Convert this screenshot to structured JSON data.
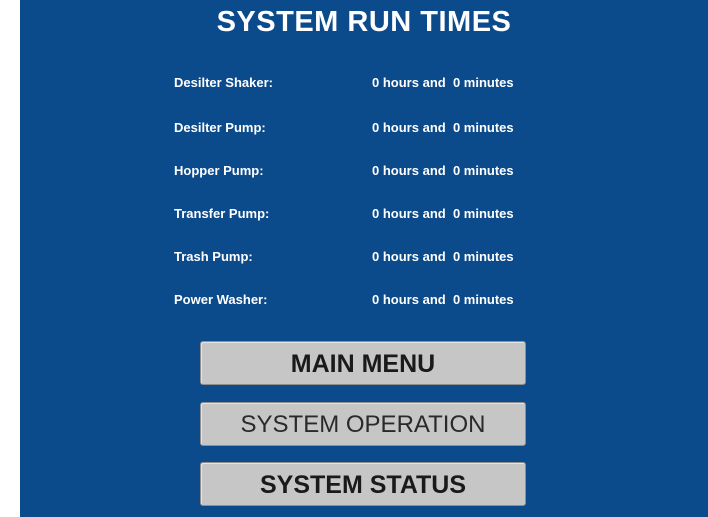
{
  "title": "SYSTEM RUN TIMES",
  "rows": [
    {
      "label": "Desilter Shaker:",
      "hours": "0",
      "minutes": "0"
    },
    {
      "label": "Desilter Pump:",
      "hours": "0",
      "minutes": "0"
    },
    {
      "label": "Hopper Pump:",
      "hours": "0",
      "minutes": "0"
    },
    {
      "label": "Transfer Pump:",
      "hours": "0",
      "minutes": "0"
    },
    {
      "label": "Trash Pump:",
      "hours": "0",
      "minutes": "0"
    },
    {
      "label": "Power Washer:",
      "hours": "0",
      "minutes": "0"
    }
  ],
  "units": {
    "hours_word": "hours and",
    "minutes_word": "minutes"
  },
  "buttons": {
    "main_menu": "MAIN MENU",
    "system_operation": "SYSTEM OPERATION",
    "system_status": "SYSTEM STATUS"
  },
  "colors": {
    "background": "#0b4a8b",
    "text": "#ffffff",
    "button": "#c6c6c6"
  }
}
